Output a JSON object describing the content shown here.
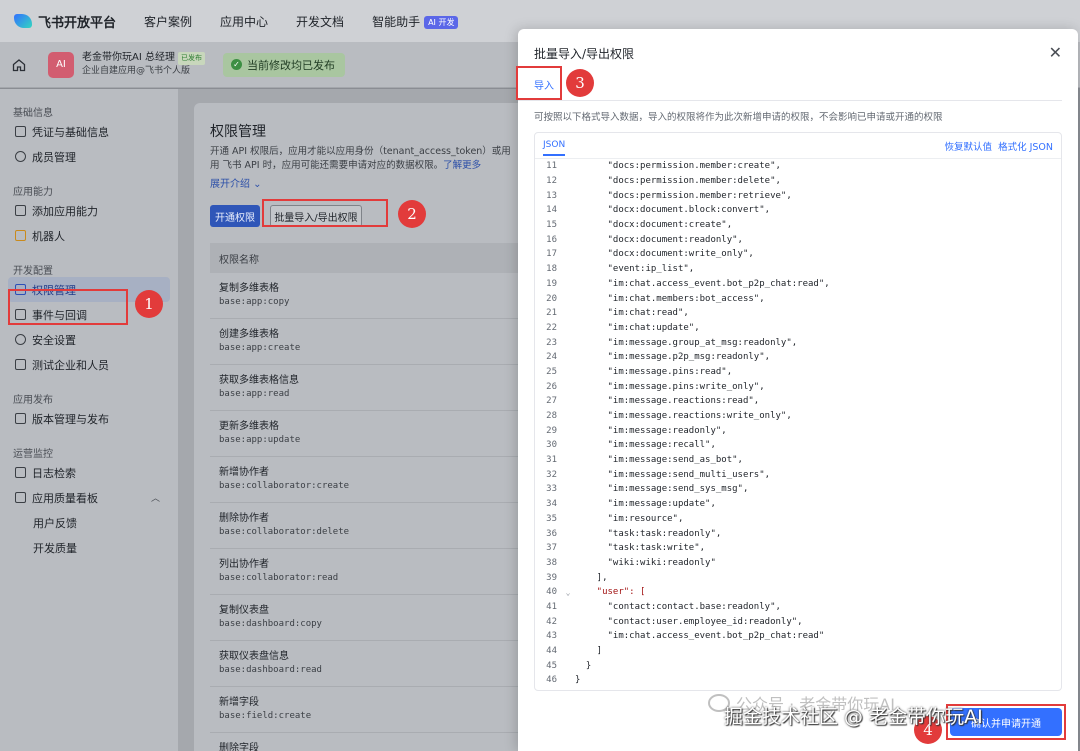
{
  "topnav": {
    "brand": "飞书开放平台",
    "items": [
      "客户案例",
      "应用中心",
      "开发文档",
      "智能助手"
    ],
    "ai_badge": "AI 开发"
  },
  "appbar": {
    "avatar_text": "AI",
    "app_name": "老金带你玩AI 总经理",
    "app_tag": "已发布",
    "app_sub": "企业自建应用@飞书个人版",
    "publish_status": "当前修改均已发布"
  },
  "sidebar": {
    "sections": [
      {
        "title": "基础信息",
        "items": [
          "凭证与基础信息",
          "成员管理"
        ]
      },
      {
        "title": "应用能力",
        "items": [
          "添加应用能力",
          "机器人"
        ]
      },
      {
        "title": "开发配置",
        "items": [
          "权限管理",
          "事件与回调",
          "安全设置",
          "测试企业和人员"
        ]
      },
      {
        "title": "应用发布",
        "items": [
          "版本管理与发布"
        ]
      },
      {
        "title": "运营监控",
        "items": [
          "日志检索",
          "应用质量看板",
          "用户反馈",
          "开发质量"
        ]
      }
    ]
  },
  "main": {
    "title": "权限管理",
    "desc_line1": "开通 API 权限后，应用才能以应用身份（tenant_access_token）或用户身份",
    "desc_line2": "用 飞书 API 时，应用可能还需要申请对应的数据权限。",
    "learn_more": "了解更多",
    "expand": "展开介绍 ⌄",
    "btn_open": "开通权限",
    "btn_batch": "批量导入/导出权限",
    "table_header": "权限名称",
    "permissions": [
      {
        "name": "复制多维表格",
        "code": "base:app:copy"
      },
      {
        "name": "创建多维表格",
        "code": "base:app:create"
      },
      {
        "name": "获取多维表格信息",
        "code": "base:app:read"
      },
      {
        "name": "更新多维表格",
        "code": "base:app:update"
      },
      {
        "name": "新增协作者",
        "code": "base:collaborator:create"
      },
      {
        "name": "删除协作者",
        "code": "base:collaborator:delete"
      },
      {
        "name": "列出协作者",
        "code": "base:collaborator:read"
      },
      {
        "name": "复制仪表盘",
        "code": "base:dashboard:copy"
      },
      {
        "name": "获取仪表盘信息",
        "code": "base:dashboard:read"
      },
      {
        "name": "新增字段",
        "code": "base:field:create"
      },
      {
        "name": "删除字段",
        "code": ""
      }
    ]
  },
  "modal": {
    "title": "批量导入/导出权限",
    "tab": "导入",
    "desc": "可按照以下格式导入数据，导入的权限将作为此次新增申请的权限，不会影响已申请或开通的权限",
    "editor_tab": "JSON",
    "restore": "恢复默认值",
    "format": "格式化 JSON",
    "confirm": "确认并申请开通"
  },
  "code_lines": [
    {
      "n": "11",
      "t": "      \"docs:permission.member:create\","
    },
    {
      "n": "12",
      "t": "      \"docs:permission.member:delete\","
    },
    {
      "n": "13",
      "t": "      \"docs:permission.member:retrieve\","
    },
    {
      "n": "14",
      "t": "      \"docx:document.block:convert\","
    },
    {
      "n": "15",
      "t": "      \"docx:document:create\","
    },
    {
      "n": "16",
      "t": "      \"docx:document:readonly\","
    },
    {
      "n": "17",
      "t": "      \"docx:document:write_only\","
    },
    {
      "n": "18",
      "t": "      \"event:ip_list\","
    },
    {
      "n": "19",
      "t": "      \"im:chat.access_event.bot_p2p_chat:read\","
    },
    {
      "n": "20",
      "t": "      \"im:chat.members:bot_access\","
    },
    {
      "n": "21",
      "t": "      \"im:chat:read\","
    },
    {
      "n": "22",
      "t": "      \"im:chat:update\","
    },
    {
      "n": "23",
      "t": "      \"im:message.group_at_msg:readonly\","
    },
    {
      "n": "24",
      "t": "      \"im:message.p2p_msg:readonly\","
    },
    {
      "n": "25",
      "t": "      \"im:message.pins:read\","
    },
    {
      "n": "26",
      "t": "      \"im:message.pins:write_only\","
    },
    {
      "n": "27",
      "t": "      \"im:message.reactions:read\","
    },
    {
      "n": "28",
      "t": "      \"im:message.reactions:write_only\","
    },
    {
      "n": "29",
      "t": "      \"im:message:readonly\","
    },
    {
      "n": "30",
      "t": "      \"im:message:recall\","
    },
    {
      "n": "31",
      "t": "      \"im:message:send_as_bot\","
    },
    {
      "n": "32",
      "t": "      \"im:message:send_multi_users\","
    },
    {
      "n": "33",
      "t": "      \"im:message:send_sys_msg\","
    },
    {
      "n": "34",
      "t": "      \"im:message:update\","
    },
    {
      "n": "35",
      "t": "      \"im:resource\","
    },
    {
      "n": "36",
      "t": "      \"task:task:readonly\","
    },
    {
      "n": "37",
      "t": "      \"task:task:write\","
    },
    {
      "n": "38",
      "t": "      \"wiki:wiki:readonly\""
    },
    {
      "n": "39",
      "t": "    ],"
    },
    {
      "n": "40",
      "t": "    \"user\": [",
      "fold": "⌄"
    },
    {
      "n": "41",
      "t": "      \"contact:contact.base:readonly\","
    },
    {
      "n": "42",
      "t": "      \"contact:user.employee_id:readonly\","
    },
    {
      "n": "43",
      "t": "      \"im:chat.access_event.bot_p2p_chat:read\""
    },
    {
      "n": "44",
      "t": "    ]"
    },
    {
      "n": "45",
      "t": "  }"
    },
    {
      "n": "46",
      "t": "}"
    }
  ],
  "annotations": [
    "1",
    "2",
    "3",
    "4"
  ],
  "watermark": {
    "line1": "公众号 · 老金带你玩AI",
    "line2": "掘金技术社区 @ 老金带你玩AI"
  },
  "colors": {
    "accent": "#3370ff",
    "annotation_red": "#e23b3b",
    "overlay": "#8a8d93"
  }
}
